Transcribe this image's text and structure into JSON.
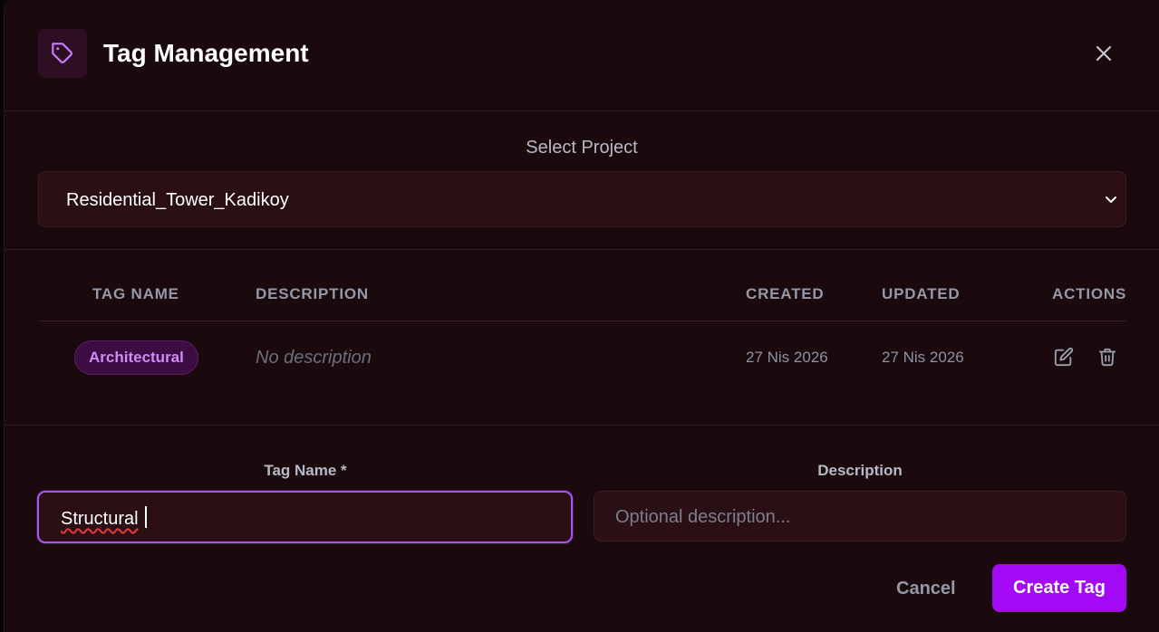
{
  "header": {
    "title": "Tag Management",
    "icon": "tag-icon",
    "close_icon": "close-icon"
  },
  "project": {
    "label": "Select Project",
    "selected": "Residential_Tower_Kadikoy"
  },
  "table": {
    "columns": [
      "TAG NAME",
      "DESCRIPTION",
      "CREATED",
      "UPDATED",
      "ACTIONS"
    ],
    "rows": [
      {
        "name": "Architectural",
        "description": "No description",
        "created": "27 Nis 2026",
        "updated": "27 Nis 2026"
      }
    ]
  },
  "form": {
    "name_label": "Tag Name *",
    "name_value": "Structural",
    "desc_label": "Description",
    "desc_placeholder": "Optional description...",
    "cancel_label": "Cancel",
    "create_label": "Create Tag"
  },
  "colors": {
    "accent": "#a309f5",
    "focus_border": "#a855f7",
    "tag_pill_text": "#d18bf5",
    "background": "#1a0a0d"
  }
}
